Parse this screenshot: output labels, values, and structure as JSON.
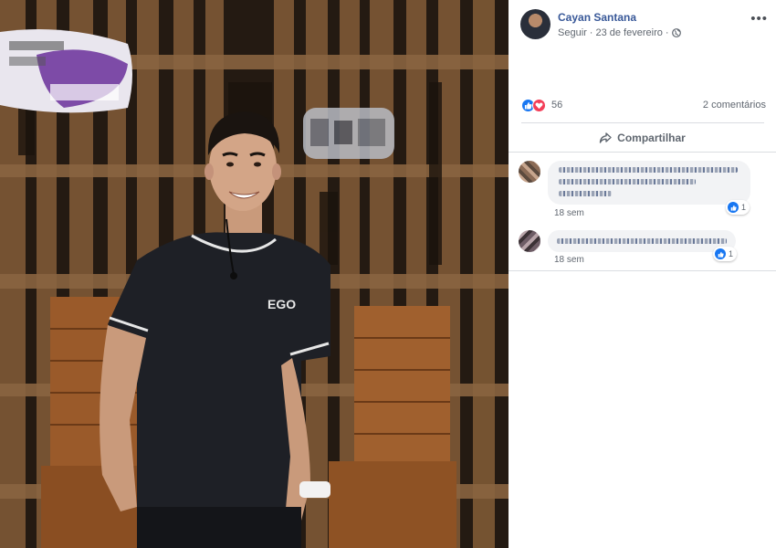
{
  "post": {
    "author": "Cayan Santana",
    "follow": "Seguir",
    "separator": "·",
    "date": "23 de fevereiro",
    "date_separator": "·",
    "more": "•••"
  },
  "reactions": {
    "count": "56",
    "comments": "2 comentários"
  },
  "actions": {
    "share": "Compartilhar"
  },
  "comments": [
    {
      "time": "18 sem",
      "reaction_count": "1"
    },
    {
      "time": "18 sem",
      "reaction_count": "1"
    }
  ],
  "photo": {
    "shirt_logo": "EGO"
  },
  "colors": {
    "link": "#385898",
    "meta": "#606770",
    "like_blue": "#1877f2",
    "love_red": "#f33e58",
    "bubble": "#f2f3f5"
  }
}
